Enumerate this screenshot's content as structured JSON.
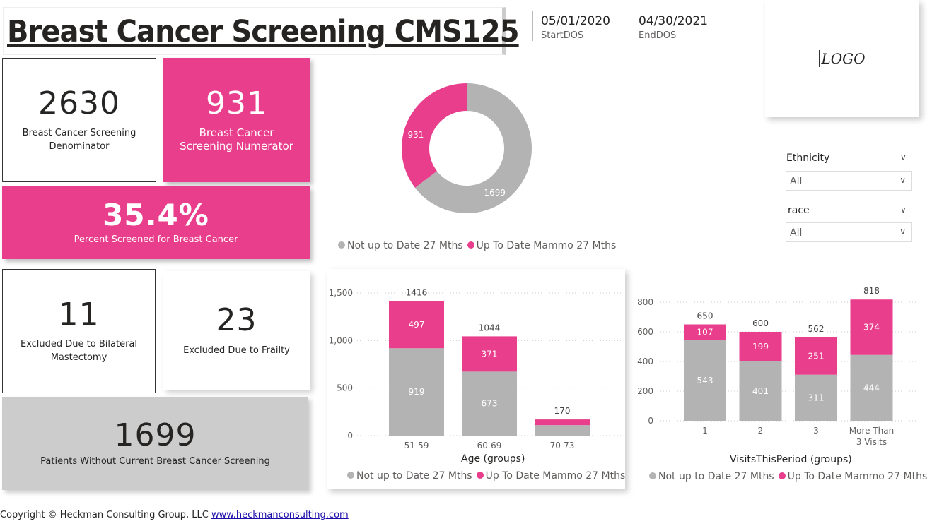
{
  "header": {
    "title": "Breast Cancer Screening CMS125",
    "start_date": "05/01/2020",
    "start_label": "StartDOS",
    "end_date": "04/30/2021",
    "end_label": "EndDOS",
    "logo": "LOGO"
  },
  "kpis": {
    "denominator": {
      "value": "2630",
      "label": "Breast Cancer Screening Denominator"
    },
    "numerator": {
      "value": "931",
      "label": "Breast Cancer Screening Numerator"
    },
    "percent": {
      "value": "35.4%",
      "label": "Percent Screened for Breast Cancer"
    },
    "mastectomy": {
      "value": "11",
      "label": "Excluded Due to Bilateral Mastectomy"
    },
    "frailty": {
      "value": "23",
      "label": "Excluded Due to Frailty"
    },
    "without": {
      "value": "1699",
      "label": "Patients Without Current Breast Cancer Screening"
    }
  },
  "slicers": [
    {
      "title": "Ethnicity",
      "value": "All"
    },
    {
      "title": "race",
      "value": "All"
    }
  ],
  "colors": {
    "pink": "#E83E8C",
    "gray": "#B3B3B3"
  },
  "legend": {
    "gray": "Not up to Date 27 Mths",
    "pink": "Up To Date Mammo 27 Mths"
  },
  "footer": {
    "text": "Copyright © Heckman Consulting Group, LLC ",
    "link": "www.heckmanconsulting.com"
  },
  "chart_data": [
    {
      "type": "pie",
      "variant": "donut",
      "categories": [
        "Not up to Date 27 Mths",
        "Up To Date Mammo 27 Mths"
      ],
      "values": [
        1699,
        931
      ],
      "labels": [
        "1699",
        "931"
      ],
      "legend": "bottom"
    },
    {
      "type": "bar",
      "stacked": true,
      "xlabel": "Age (groups)",
      "categories": [
        "51-59",
        "60-69",
        "70-73"
      ],
      "series": [
        {
          "name": "Not up to Date 27 Mths",
          "values": [
            919,
            673,
            110
          ]
        },
        {
          "name": "Up To Date Mammo 27 Mths",
          "values": [
            497,
            371,
            60
          ]
        }
      ],
      "segment_labels": [
        [
          "919",
          "673",
          ""
        ],
        [
          "497",
          "371",
          ""
        ]
      ],
      "totals": [
        "1416",
        "1044",
        "170"
      ],
      "yticks": [
        "0",
        "500",
        "1,000",
        "1,500"
      ],
      "ylim": [
        0,
        1500
      ],
      "grid": true,
      "legend": "bottom"
    },
    {
      "type": "bar",
      "stacked": true,
      "xlabel": "VisitsThisPeriod (groups)",
      "categories": [
        "1",
        "2",
        "3",
        "More Than 3 Visits"
      ],
      "series": [
        {
          "name": "Not up to Date 27 Mths",
          "values": [
            543,
            401,
            311,
            444
          ]
        },
        {
          "name": "Up To Date Mammo 27 Mths",
          "values": [
            107,
            199,
            251,
            374
          ]
        }
      ],
      "segment_labels": [
        [
          "543",
          "401",
          "311",
          "444"
        ],
        [
          "107",
          "199",
          "251",
          "374"
        ]
      ],
      "totals": [
        "650",
        "600",
        "562",
        "818"
      ],
      "yticks": [
        "0",
        "200",
        "400",
        "600",
        "800"
      ],
      "ylim": [
        0,
        800
      ],
      "grid": true,
      "legend": "bottom"
    }
  ]
}
